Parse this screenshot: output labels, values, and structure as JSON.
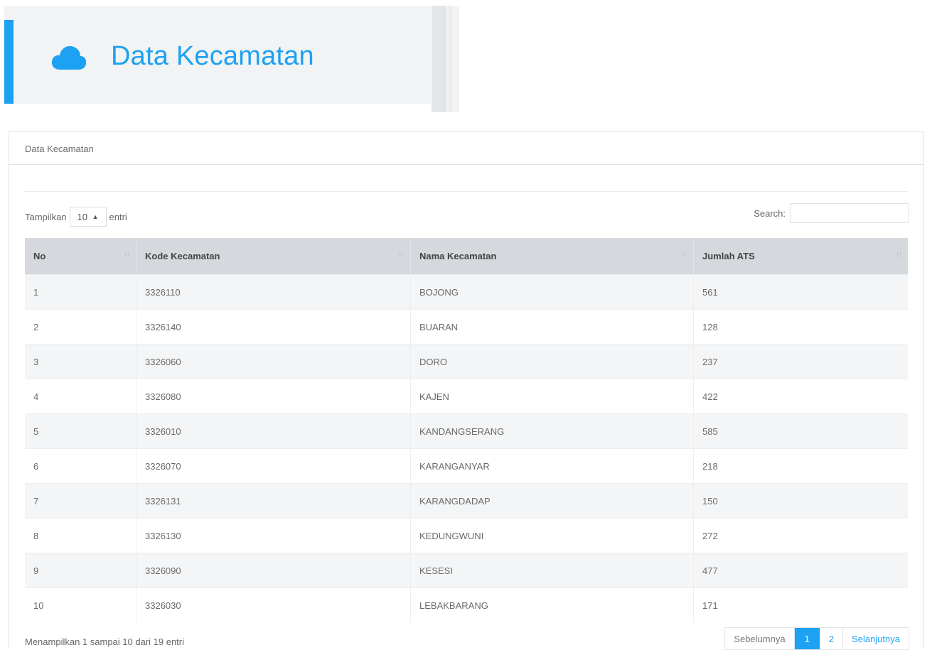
{
  "header": {
    "title": "Data Kecamatan",
    "icon": "cloud-icon",
    "accent_color": "#1da1f2"
  },
  "panel": {
    "heading": "Data Kecamatan"
  },
  "controls": {
    "length_label_before": "Tampilkan",
    "length_value": "10",
    "length_label_after": "entri",
    "search_label": "Search:",
    "search_value": ""
  },
  "table": {
    "columns": [
      "No",
      "Kode Kecamatan",
      "Nama Kecamatan",
      "Jumlah ATS"
    ],
    "rows": [
      [
        "1",
        "3326110",
        "BOJONG",
        "561"
      ],
      [
        "2",
        "3326140",
        "BUARAN",
        "128"
      ],
      [
        "3",
        "3326060",
        "DORO",
        "237"
      ],
      [
        "4",
        "3326080",
        "KAJEN",
        "422"
      ],
      [
        "5",
        "3326010",
        "KANDANGSERANG",
        "585"
      ],
      [
        "6",
        "3326070",
        "KARANGANYAR",
        "218"
      ],
      [
        "7",
        "3326131",
        "KARANGDADAP",
        "150"
      ],
      [
        "8",
        "3326130",
        "KEDUNGWUNI",
        "272"
      ],
      [
        "9",
        "3326090",
        "KESESI",
        "477"
      ],
      [
        "10",
        "3326030",
        "LEBAKBARANG",
        "171"
      ]
    ]
  },
  "footer": {
    "info": "Menampilkan 1 sampai 10 dari 19 entri",
    "pagination": {
      "previous": "Sebelumnya",
      "pages": [
        "1",
        "2"
      ],
      "active_page": "1",
      "next": "Selanjutnya"
    }
  }
}
